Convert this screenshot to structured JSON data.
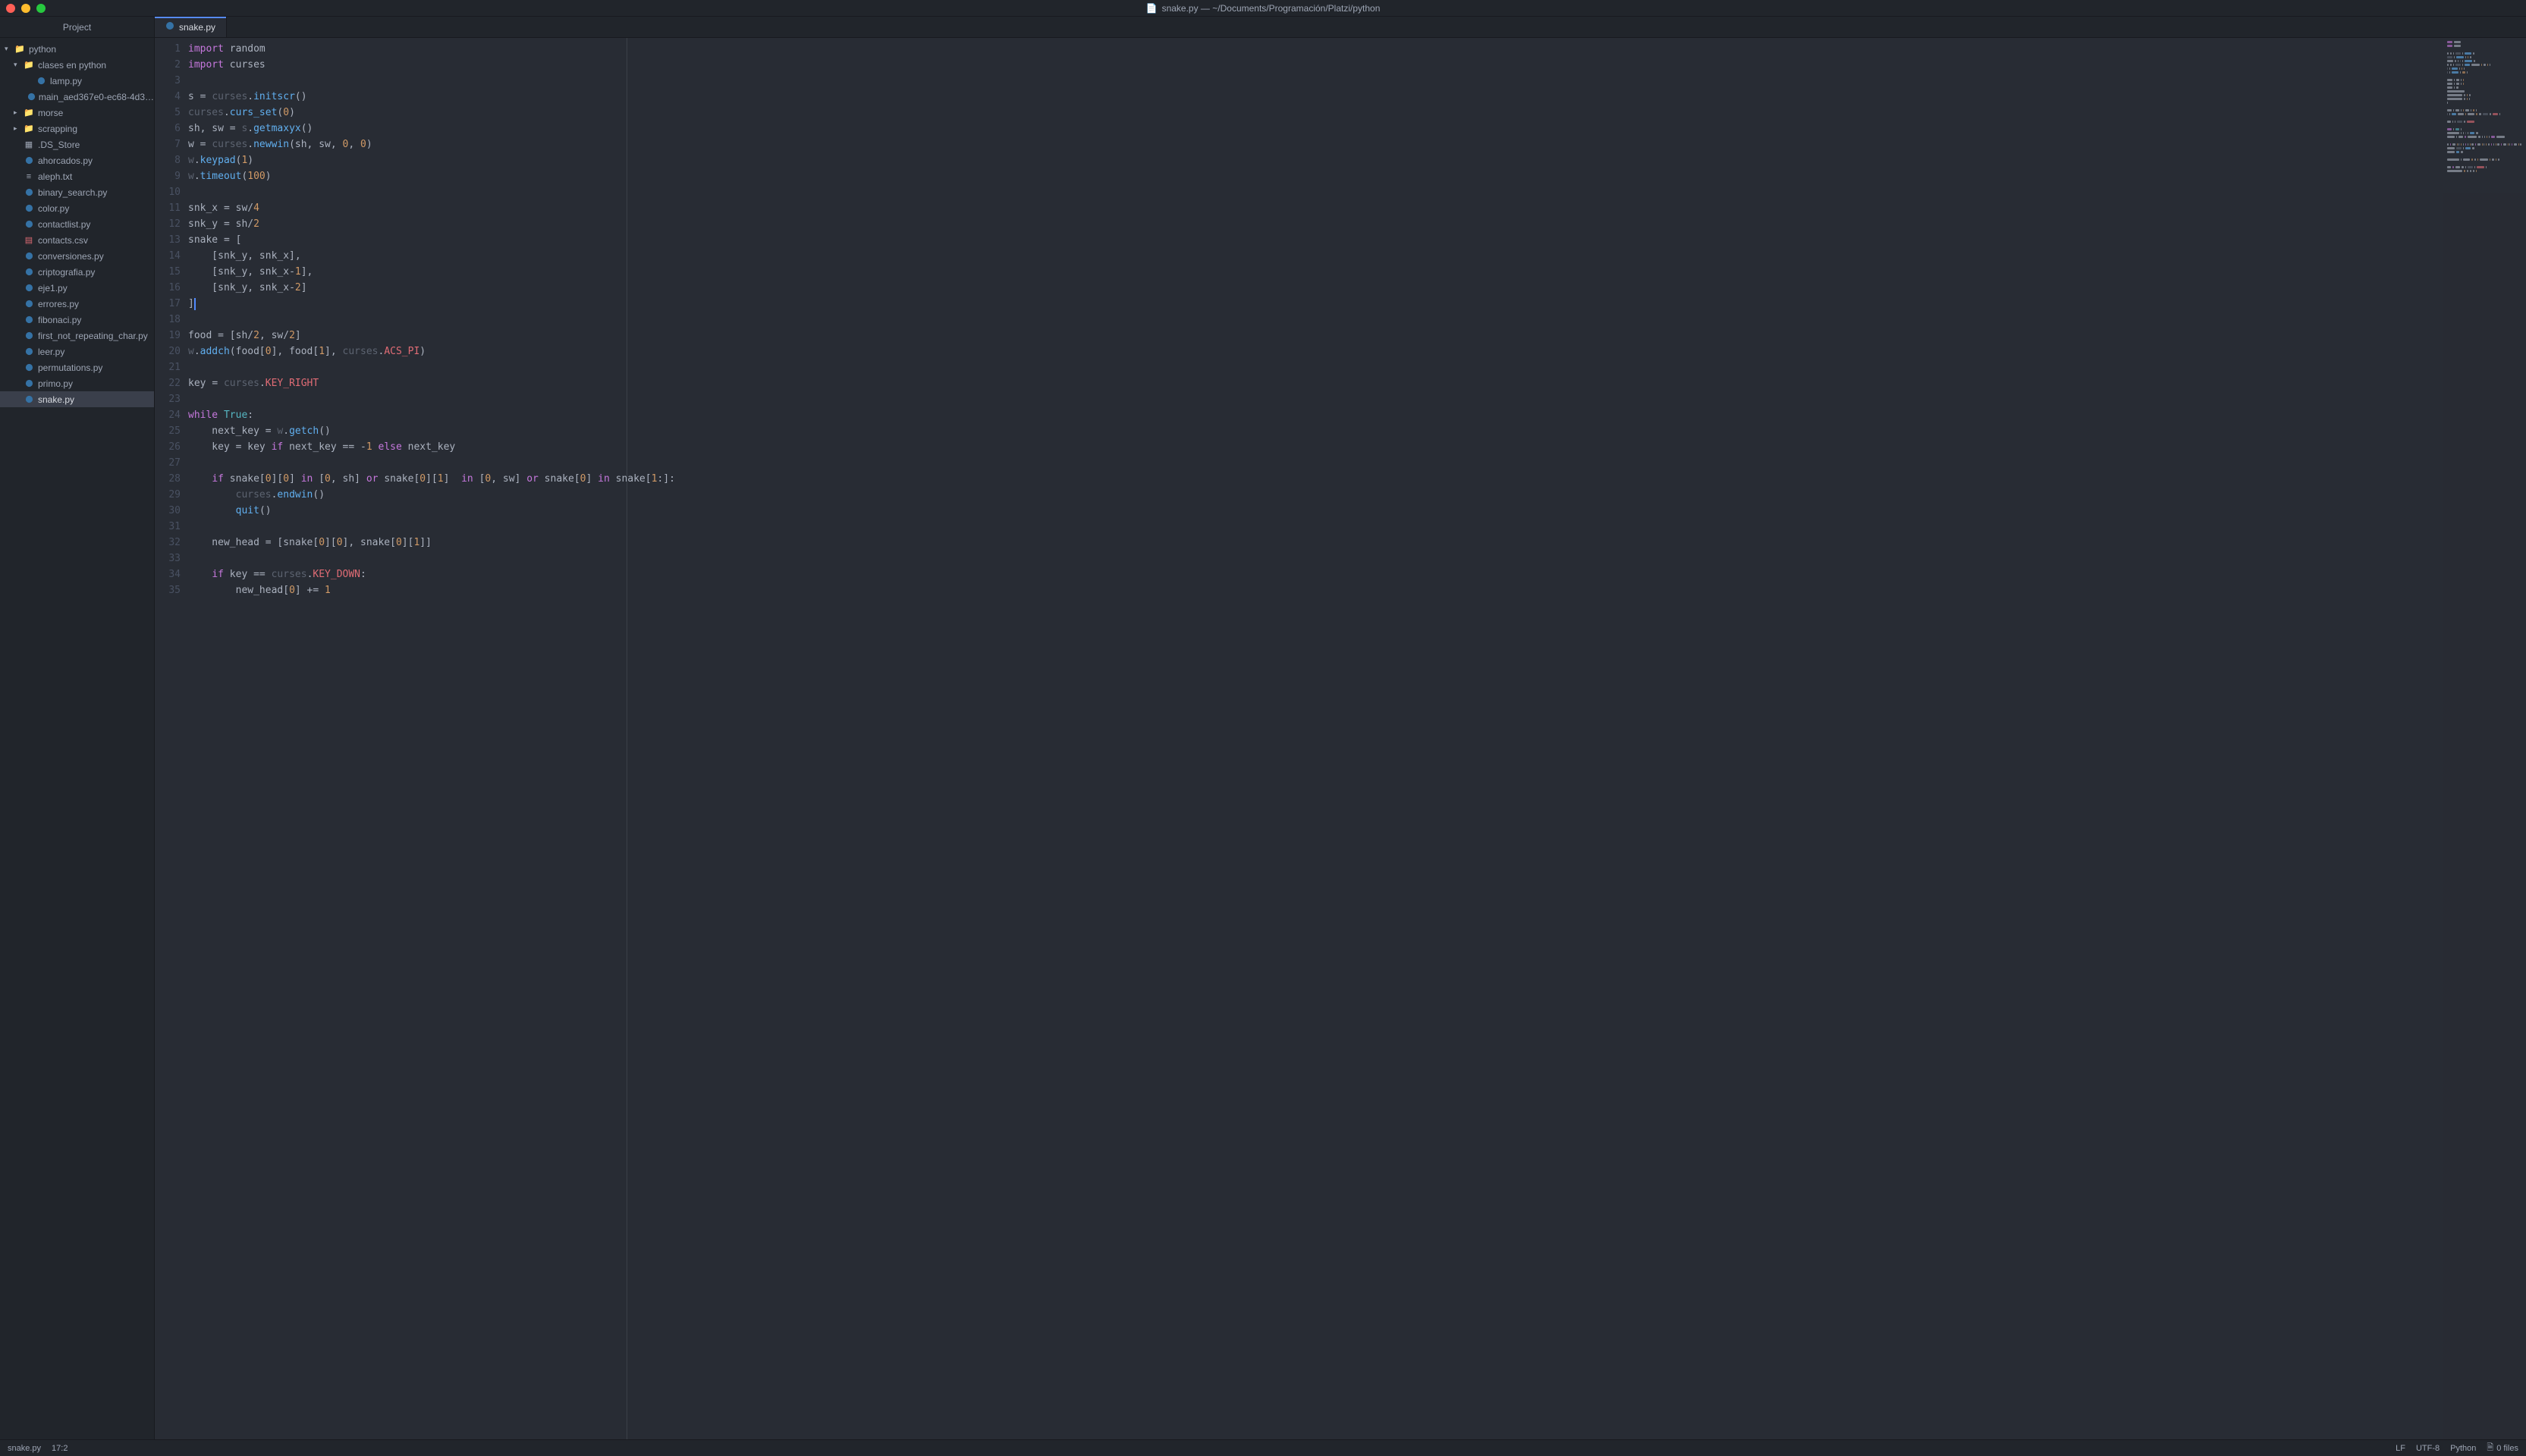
{
  "titlebar": {
    "title": "snake.py — ~/Documents/Programación/Platzi/python"
  },
  "sidebar": {
    "header": "Project",
    "tree": [
      {
        "label": "python",
        "type": "folder",
        "depth": 0,
        "expanded": true
      },
      {
        "label": "clases en python",
        "type": "folder",
        "depth": 1,
        "expanded": true
      },
      {
        "label": "lamp.py",
        "type": "python",
        "depth": 2
      },
      {
        "label": "main_aed367e0-ec68-4d3…",
        "type": "python",
        "depth": 2
      },
      {
        "label": "morse",
        "type": "folder",
        "depth": 1,
        "expanded": false
      },
      {
        "label": "scrapping",
        "type": "folder",
        "depth": 1,
        "expanded": false
      },
      {
        "label": ".DS_Store",
        "type": "binary",
        "depth": 1
      },
      {
        "label": "ahorcados.py",
        "type": "python",
        "depth": 1
      },
      {
        "label": "aleph.txt",
        "type": "text",
        "depth": 1
      },
      {
        "label": "binary_search.py",
        "type": "python",
        "depth": 1
      },
      {
        "label": "color.py",
        "type": "python",
        "depth": 1
      },
      {
        "label": "contactlist.py",
        "type": "python",
        "depth": 1
      },
      {
        "label": "contacts.csv",
        "type": "csv",
        "depth": 1
      },
      {
        "label": "conversiones.py",
        "type": "python",
        "depth": 1
      },
      {
        "label": "criptografia.py",
        "type": "python",
        "depth": 1
      },
      {
        "label": "eje1.py",
        "type": "python",
        "depth": 1
      },
      {
        "label": "errores.py",
        "type": "python",
        "depth": 1
      },
      {
        "label": "fibonaci.py",
        "type": "python",
        "depth": 1
      },
      {
        "label": "first_not_repeating_char.py",
        "type": "python",
        "depth": 1
      },
      {
        "label": "leer.py",
        "type": "python",
        "depth": 1
      },
      {
        "label": "permutations.py",
        "type": "python",
        "depth": 1
      },
      {
        "label": "primo.py",
        "type": "python",
        "depth": 1
      },
      {
        "label": "snake.py",
        "type": "python",
        "depth": 1,
        "selected": true
      }
    ]
  },
  "tabs": [
    {
      "label": "snake.py",
      "icon": "python",
      "active": true
    }
  ],
  "code_lines": [
    [
      [
        "kw",
        "import"
      ],
      [
        "",
        " random"
      ]
    ],
    [
      [
        "kw",
        "import"
      ],
      [
        "",
        " curses"
      ]
    ],
    [
      [
        "",
        ""
      ]
    ],
    [
      [
        "",
        "s "
      ],
      [
        "op",
        "="
      ],
      [
        "",
        " "
      ],
      [
        "dim",
        "curses"
      ],
      [
        "op",
        "."
      ],
      [
        "fn",
        "initscr"
      ],
      [
        "op",
        "()"
      ]
    ],
    [
      [
        "dim",
        "curses"
      ],
      [
        "op",
        "."
      ],
      [
        "fn",
        "curs_set"
      ],
      [
        "op",
        "("
      ],
      [
        "num",
        "0"
      ],
      [
        "op",
        ")"
      ]
    ],
    [
      [
        "",
        "sh, sw "
      ],
      [
        "op",
        "="
      ],
      [
        "",
        " "
      ],
      [
        "dim",
        "s"
      ],
      [
        "op",
        "."
      ],
      [
        "fn",
        "getmaxyx"
      ],
      [
        "op",
        "()"
      ]
    ],
    [
      [
        "",
        "w "
      ],
      [
        "op",
        "="
      ],
      [
        "",
        " "
      ],
      [
        "dim",
        "curses"
      ],
      [
        "op",
        "."
      ],
      [
        "fn",
        "newwin"
      ],
      [
        "op",
        "(sh, sw, "
      ],
      [
        "num",
        "0"
      ],
      [
        "op",
        ", "
      ],
      [
        "num",
        "0"
      ],
      [
        "op",
        ")"
      ]
    ],
    [
      [
        "dim",
        "w"
      ],
      [
        "op",
        "."
      ],
      [
        "fn",
        "keypad"
      ],
      [
        "op",
        "("
      ],
      [
        "num",
        "1"
      ],
      [
        "op",
        ")"
      ]
    ],
    [
      [
        "dim",
        "w"
      ],
      [
        "op",
        "."
      ],
      [
        "fn",
        "timeout"
      ],
      [
        "op",
        "("
      ],
      [
        "num",
        "100"
      ],
      [
        "op",
        ")"
      ]
    ],
    [
      [
        "",
        ""
      ]
    ],
    [
      [
        "",
        "snk_x "
      ],
      [
        "op",
        "="
      ],
      [
        "",
        " sw"
      ],
      [
        "op",
        "/"
      ],
      [
        "num",
        "4"
      ]
    ],
    [
      [
        "",
        "snk_y "
      ],
      [
        "op",
        "="
      ],
      [
        "",
        " sh"
      ],
      [
        "op",
        "/"
      ],
      [
        "num",
        "2"
      ]
    ],
    [
      [
        "",
        "snake "
      ],
      [
        "op",
        "="
      ],
      [
        "",
        " ["
      ]
    ],
    [
      [
        "",
        "    [snk_y, snk_x],"
      ]
    ],
    [
      [
        "",
        "    [snk_y, snk_x"
      ],
      [
        "op",
        "-"
      ],
      [
        "num",
        "1"
      ],
      [
        "op",
        "],"
      ]
    ],
    [
      [
        "",
        "    [snk_y, snk_x"
      ],
      [
        "op",
        "-"
      ],
      [
        "num",
        "2"
      ],
      [
        "op",
        "]"
      ]
    ],
    [
      [
        "op",
        "]"
      ]
    ],
    [
      [
        "",
        ""
      ]
    ],
    [
      [
        "",
        "food "
      ],
      [
        "op",
        "="
      ],
      [
        "",
        " [sh"
      ],
      [
        "op",
        "/"
      ],
      [
        "num",
        "2"
      ],
      [
        "op",
        ", sw"
      ],
      [
        "op",
        "/"
      ],
      [
        "num",
        "2"
      ],
      [
        "op",
        "]"
      ]
    ],
    [
      [
        "dim",
        "w"
      ],
      [
        "op",
        "."
      ],
      [
        "fn",
        "addch"
      ],
      [
        "op",
        "(food["
      ],
      [
        "num",
        "0"
      ],
      [
        "op",
        "], food["
      ],
      [
        "num",
        "1"
      ],
      [
        "op",
        "], "
      ],
      [
        "dim",
        "curses"
      ],
      [
        "op",
        "."
      ],
      [
        "const",
        "ACS_PI"
      ],
      [
        "op",
        ")"
      ]
    ],
    [
      [
        "",
        ""
      ]
    ],
    [
      [
        "",
        "key "
      ],
      [
        "op",
        "="
      ],
      [
        "",
        " "
      ],
      [
        "dim",
        "curses"
      ],
      [
        "op",
        "."
      ],
      [
        "const",
        "KEY_RIGHT"
      ]
    ],
    [
      [
        "",
        ""
      ]
    ],
    [
      [
        "kw",
        "while"
      ],
      [
        "",
        " "
      ],
      [
        "builtin",
        "True"
      ],
      [
        "op",
        ":"
      ]
    ],
    [
      [
        "",
        "    next_key "
      ],
      [
        "op",
        "="
      ],
      [
        "",
        " "
      ],
      [
        "dim",
        "w"
      ],
      [
        "op",
        "."
      ],
      [
        "fn",
        "getch"
      ],
      [
        "op",
        "()"
      ]
    ],
    [
      [
        "",
        "    key "
      ],
      [
        "op",
        "="
      ],
      [
        "",
        " key "
      ],
      [
        "kw",
        "if"
      ],
      [
        "",
        " next_key "
      ],
      [
        "op",
        "=="
      ],
      [
        "",
        " "
      ],
      [
        "op",
        "-"
      ],
      [
        "num",
        "1"
      ],
      [
        "",
        " "
      ],
      [
        "kw",
        "else"
      ],
      [
        "",
        " next_key"
      ]
    ],
    [
      [
        "",
        ""
      ]
    ],
    [
      [
        "",
        "    "
      ],
      [
        "kw",
        "if"
      ],
      [
        "",
        " snake["
      ],
      [
        "num",
        "0"
      ],
      [
        "op",
        "]["
      ],
      [
        "num",
        "0"
      ],
      [
        "op",
        "] "
      ],
      [
        "kw",
        "in"
      ],
      [
        "",
        " ["
      ],
      [
        "num",
        "0"
      ],
      [
        "op",
        ", sh] "
      ],
      [
        "kw",
        "or"
      ],
      [
        "",
        " snake["
      ],
      [
        "num",
        "0"
      ],
      [
        "op",
        "]["
      ],
      [
        "num",
        "1"
      ],
      [
        "op",
        "]  "
      ],
      [
        "kw",
        "in"
      ],
      [
        "",
        " ["
      ],
      [
        "num",
        "0"
      ],
      [
        "op",
        ", sw] "
      ],
      [
        "kw",
        "or"
      ],
      [
        "",
        " snake["
      ],
      [
        "num",
        "0"
      ],
      [
        "op",
        "] "
      ],
      [
        "kw",
        "in"
      ],
      [
        "",
        " snake["
      ],
      [
        "num",
        "1"
      ],
      [
        "op",
        ":]:"
      ]
    ],
    [
      [
        "",
        "        "
      ],
      [
        "dim",
        "curses"
      ],
      [
        "op",
        "."
      ],
      [
        "fn",
        "endwin"
      ],
      [
        "op",
        "()"
      ]
    ],
    [
      [
        "",
        "        "
      ],
      [
        "fn",
        "quit"
      ],
      [
        "op",
        "()"
      ]
    ],
    [
      [
        "",
        ""
      ]
    ],
    [
      [
        "",
        "    new_head "
      ],
      [
        "op",
        "="
      ],
      [
        "",
        " [snake["
      ],
      [
        "num",
        "0"
      ],
      [
        "op",
        "]["
      ],
      [
        "num",
        "0"
      ],
      [
        "op",
        "], snake["
      ],
      [
        "num",
        "0"
      ],
      [
        "op",
        "]["
      ],
      [
        "num",
        "1"
      ],
      [
        "op",
        "]]"
      ]
    ],
    [
      [
        "",
        ""
      ]
    ],
    [
      [
        "",
        "    "
      ],
      [
        "kw",
        "if"
      ],
      [
        "",
        " key "
      ],
      [
        "op",
        "=="
      ],
      [
        "",
        " "
      ],
      [
        "dim",
        "curses"
      ],
      [
        "op",
        "."
      ],
      [
        "const",
        "KEY_DOWN"
      ],
      [
        "op",
        ":"
      ]
    ],
    [
      [
        "",
        "        new_head["
      ],
      [
        "num",
        "0"
      ],
      [
        "op",
        "] "
      ],
      [
        "op",
        "+="
      ],
      [
        "",
        " "
      ],
      [
        "num",
        "1"
      ]
    ]
  ],
  "statusbar": {
    "filename": "snake.py",
    "position": "17:2",
    "line_ending": "LF",
    "encoding": "UTF-8",
    "language": "Python",
    "files": "0 files"
  }
}
